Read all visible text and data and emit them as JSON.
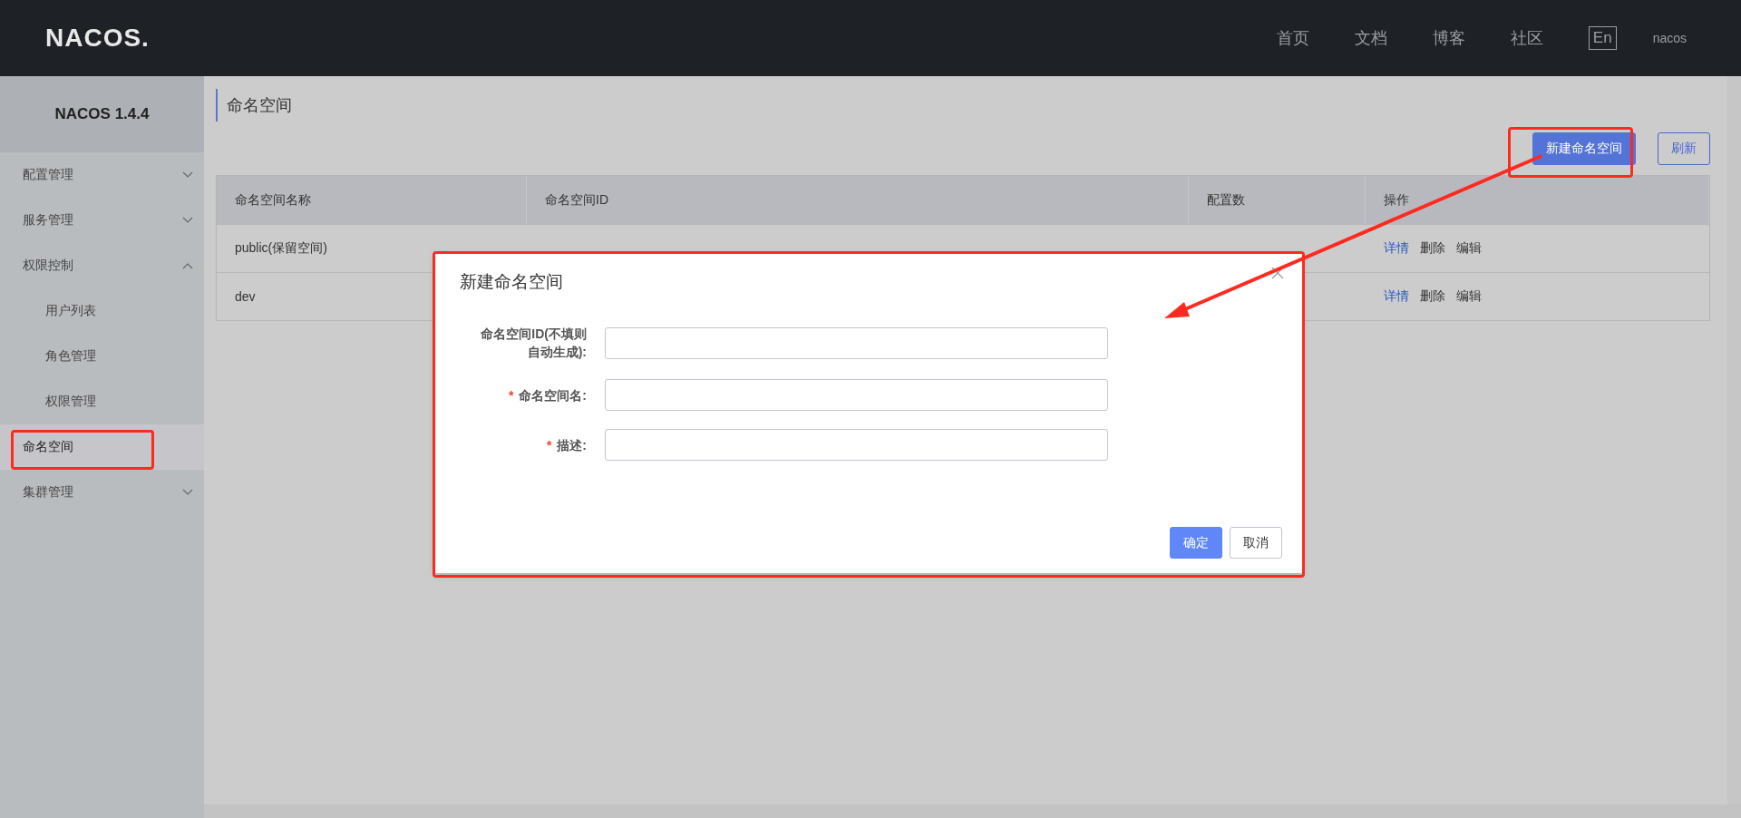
{
  "header": {
    "logo": "NACOS.",
    "nav": [
      "首页",
      "文档",
      "博客",
      "社区"
    ],
    "language": "En",
    "user": "nacos"
  },
  "sidebar": {
    "title": "NACOS 1.4.4",
    "items": [
      {
        "label": "配置管理",
        "expanded": false,
        "selected": false
      },
      {
        "label": "服务管理",
        "expanded": false,
        "selected": false
      },
      {
        "label": "权限控制",
        "expanded": true,
        "selected": false,
        "children": [
          {
            "label": "用户列表",
            "selected": false
          },
          {
            "label": "角色管理",
            "selected": false
          },
          {
            "label": "权限管理",
            "selected": false
          }
        ]
      },
      {
        "label": "命名空间",
        "selected": true
      },
      {
        "label": "集群管理",
        "expanded": false,
        "selected": false
      }
    ]
  },
  "page": {
    "title": "命名空间",
    "buttons": [
      {
        "label": "新建命名空间",
        "kind": "primary"
      },
      {
        "label": "刷新",
        "kind": "outline"
      }
    ],
    "table": {
      "columns": [
        "命名空间名称",
        "命名空间ID",
        "配置数",
        "操作"
      ],
      "rows": [
        {
          "name": "public(保留空间)",
          "actions": [
            {
              "label": "详情",
              "kind": "link"
            },
            {
              "label": "删除",
              "kind": "plain"
            },
            {
              "label": "编辑",
              "kind": "plain"
            }
          ]
        },
        {
          "name": "dev",
          "actions": [
            {
              "label": "详情",
              "kind": "link"
            },
            {
              "label": "删除",
              "kind": "plain"
            },
            {
              "label": "编辑",
              "kind": "plain"
            }
          ]
        }
      ]
    }
  },
  "dialog": {
    "title": "新建命名空间",
    "required_mark": "*",
    "fields": [
      {
        "label": "命名空间ID(不填则自动生成):",
        "required": false
      },
      {
        "label": "命名空间名:",
        "required": true
      },
      {
        "label": "描述:",
        "required": true
      }
    ],
    "buttons": [
      {
        "label": "确定",
        "kind": "primary"
      },
      {
        "label": "取消",
        "kind": "outline"
      }
    ]
  }
}
